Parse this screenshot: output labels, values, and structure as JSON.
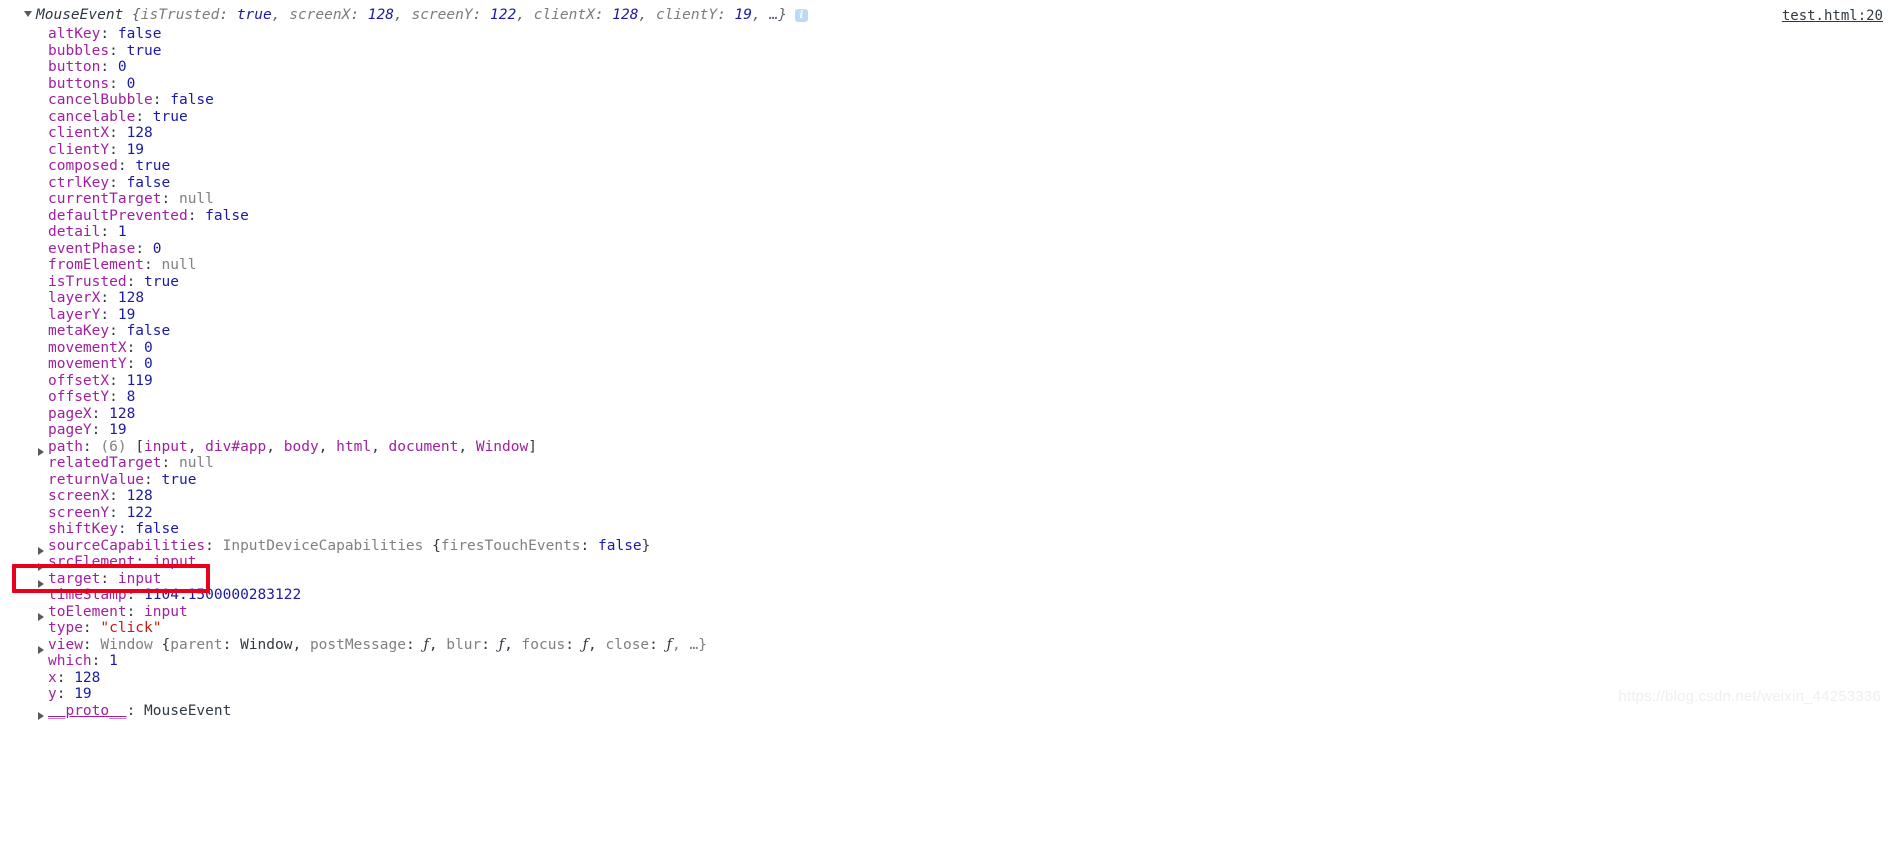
{
  "console": {
    "source_link": "test.html:20",
    "info_icon_label": "i",
    "header": {
      "constructor_name": "MouseEvent",
      "open_brace": "{",
      "close_brace": ", …}",
      "preview": [
        {
          "key": "isTrusted",
          "sep": ": ",
          "value": "true",
          "tail": ", "
        },
        {
          "key": "screenX",
          "sep": ": ",
          "value": "128",
          "tail": ", "
        },
        {
          "key": "screenY",
          "sep": ": ",
          "value": "122",
          "tail": ", "
        },
        {
          "key": "clientX",
          "sep": ": ",
          "value": "128",
          "tail": ", "
        },
        {
          "key": "clientY",
          "sep": ": ",
          "value": "19",
          "tail": ""
        }
      ]
    },
    "properties": [
      {
        "expandable": false,
        "name": "altKey",
        "value": "false",
        "kind": "bool"
      },
      {
        "expandable": false,
        "name": "bubbles",
        "value": "true",
        "kind": "bool"
      },
      {
        "expandable": false,
        "name": "button",
        "value": "0",
        "kind": "num"
      },
      {
        "expandable": false,
        "name": "buttons",
        "value": "0",
        "kind": "num"
      },
      {
        "expandable": false,
        "name": "cancelBubble",
        "value": "false",
        "kind": "bool"
      },
      {
        "expandable": false,
        "name": "cancelable",
        "value": "true",
        "kind": "bool"
      },
      {
        "expandable": false,
        "name": "clientX",
        "value": "128",
        "kind": "num"
      },
      {
        "expandable": false,
        "name": "clientY",
        "value": "19",
        "kind": "num"
      },
      {
        "expandable": false,
        "name": "composed",
        "value": "true",
        "kind": "bool"
      },
      {
        "expandable": false,
        "name": "ctrlKey",
        "value": "false",
        "kind": "bool"
      },
      {
        "expandable": false,
        "name": "currentTarget",
        "value": "null",
        "kind": "null"
      },
      {
        "expandable": false,
        "name": "defaultPrevented",
        "value": "false",
        "kind": "bool"
      },
      {
        "expandable": false,
        "name": "detail",
        "value": "1",
        "kind": "num"
      },
      {
        "expandable": false,
        "name": "eventPhase",
        "value": "0",
        "kind": "num"
      },
      {
        "expandable": false,
        "name": "fromElement",
        "value": "null",
        "kind": "null"
      },
      {
        "expandable": false,
        "name": "isTrusted",
        "value": "true",
        "kind": "bool"
      },
      {
        "expandable": false,
        "name": "layerX",
        "value": "128",
        "kind": "num"
      },
      {
        "expandable": false,
        "name": "layerY",
        "value": "19",
        "kind": "num"
      },
      {
        "expandable": false,
        "name": "metaKey",
        "value": "false",
        "kind": "bool"
      },
      {
        "expandable": false,
        "name": "movementX",
        "value": "0",
        "kind": "num"
      },
      {
        "expandable": false,
        "name": "movementY",
        "value": "0",
        "kind": "num"
      },
      {
        "expandable": false,
        "name": "offsetX",
        "value": "119",
        "kind": "num"
      },
      {
        "expandable": false,
        "name": "offsetY",
        "value": "8",
        "kind": "num"
      },
      {
        "expandable": false,
        "name": "pageX",
        "value": "128",
        "kind": "num"
      },
      {
        "expandable": false,
        "name": "pageY",
        "value": "19",
        "kind": "num"
      },
      {
        "expandable": true,
        "name": "path",
        "kind": "array",
        "count": "(6)",
        "items": [
          "input",
          "div#app",
          "body",
          "html",
          "document",
          "Window"
        ]
      },
      {
        "expandable": false,
        "name": "relatedTarget",
        "value": "null",
        "kind": "null"
      },
      {
        "expandable": false,
        "name": "returnValue",
        "value": "true",
        "kind": "bool"
      },
      {
        "expandable": false,
        "name": "screenX",
        "value": "128",
        "kind": "num"
      },
      {
        "expandable": false,
        "name": "screenY",
        "value": "122",
        "kind": "num"
      },
      {
        "expandable": false,
        "name": "shiftKey",
        "value": "false",
        "kind": "bool"
      },
      {
        "expandable": true,
        "name": "sourceCapabilities",
        "kind": "object",
        "ctor": "InputDeviceCapabilities",
        "fields": [
          {
            "key": "firesTouchEvents",
            "value": "false",
            "kind": "bool"
          }
        ]
      },
      {
        "expandable": true,
        "name": "srcElement",
        "value": "input",
        "kind": "node"
      },
      {
        "expandable": true,
        "name": "target",
        "value": "input",
        "kind": "node",
        "highlighted": true
      },
      {
        "expandable": false,
        "name": "timeStamp",
        "value": "1104.1500000283122",
        "kind": "num"
      },
      {
        "expandable": true,
        "name": "toElement",
        "value": "input",
        "kind": "node"
      },
      {
        "expandable": false,
        "name": "type",
        "value": "\"click\"",
        "kind": "str"
      },
      {
        "expandable": true,
        "name": "view",
        "kind": "window",
        "ctor": "Window",
        "fields": [
          {
            "key": "parent",
            "value": "Window",
            "kind": "ctor"
          },
          {
            "key": "postMessage",
            "value": "ƒ",
            "kind": "fn"
          },
          {
            "key": "blur",
            "value": "ƒ",
            "kind": "fn"
          },
          {
            "key": "focus",
            "value": "ƒ",
            "kind": "fn"
          },
          {
            "key": "close",
            "value": "ƒ",
            "kind": "fn"
          }
        ],
        "ellipsis": ", …}"
      },
      {
        "expandable": false,
        "name": "which",
        "value": "1",
        "kind": "num"
      },
      {
        "expandable": false,
        "name": "x",
        "value": "128",
        "kind": "num"
      },
      {
        "expandable": false,
        "name": "y",
        "value": "19",
        "kind": "num"
      },
      {
        "expandable": true,
        "name": "__proto__",
        "value": "MouseEvent",
        "kind": "ctor",
        "proto": true
      }
    ]
  },
  "annotation": {
    "color": "#e8001c",
    "target_property": "target"
  },
  "watermark": "https://blog.csdn.net/weixin_44253336"
}
